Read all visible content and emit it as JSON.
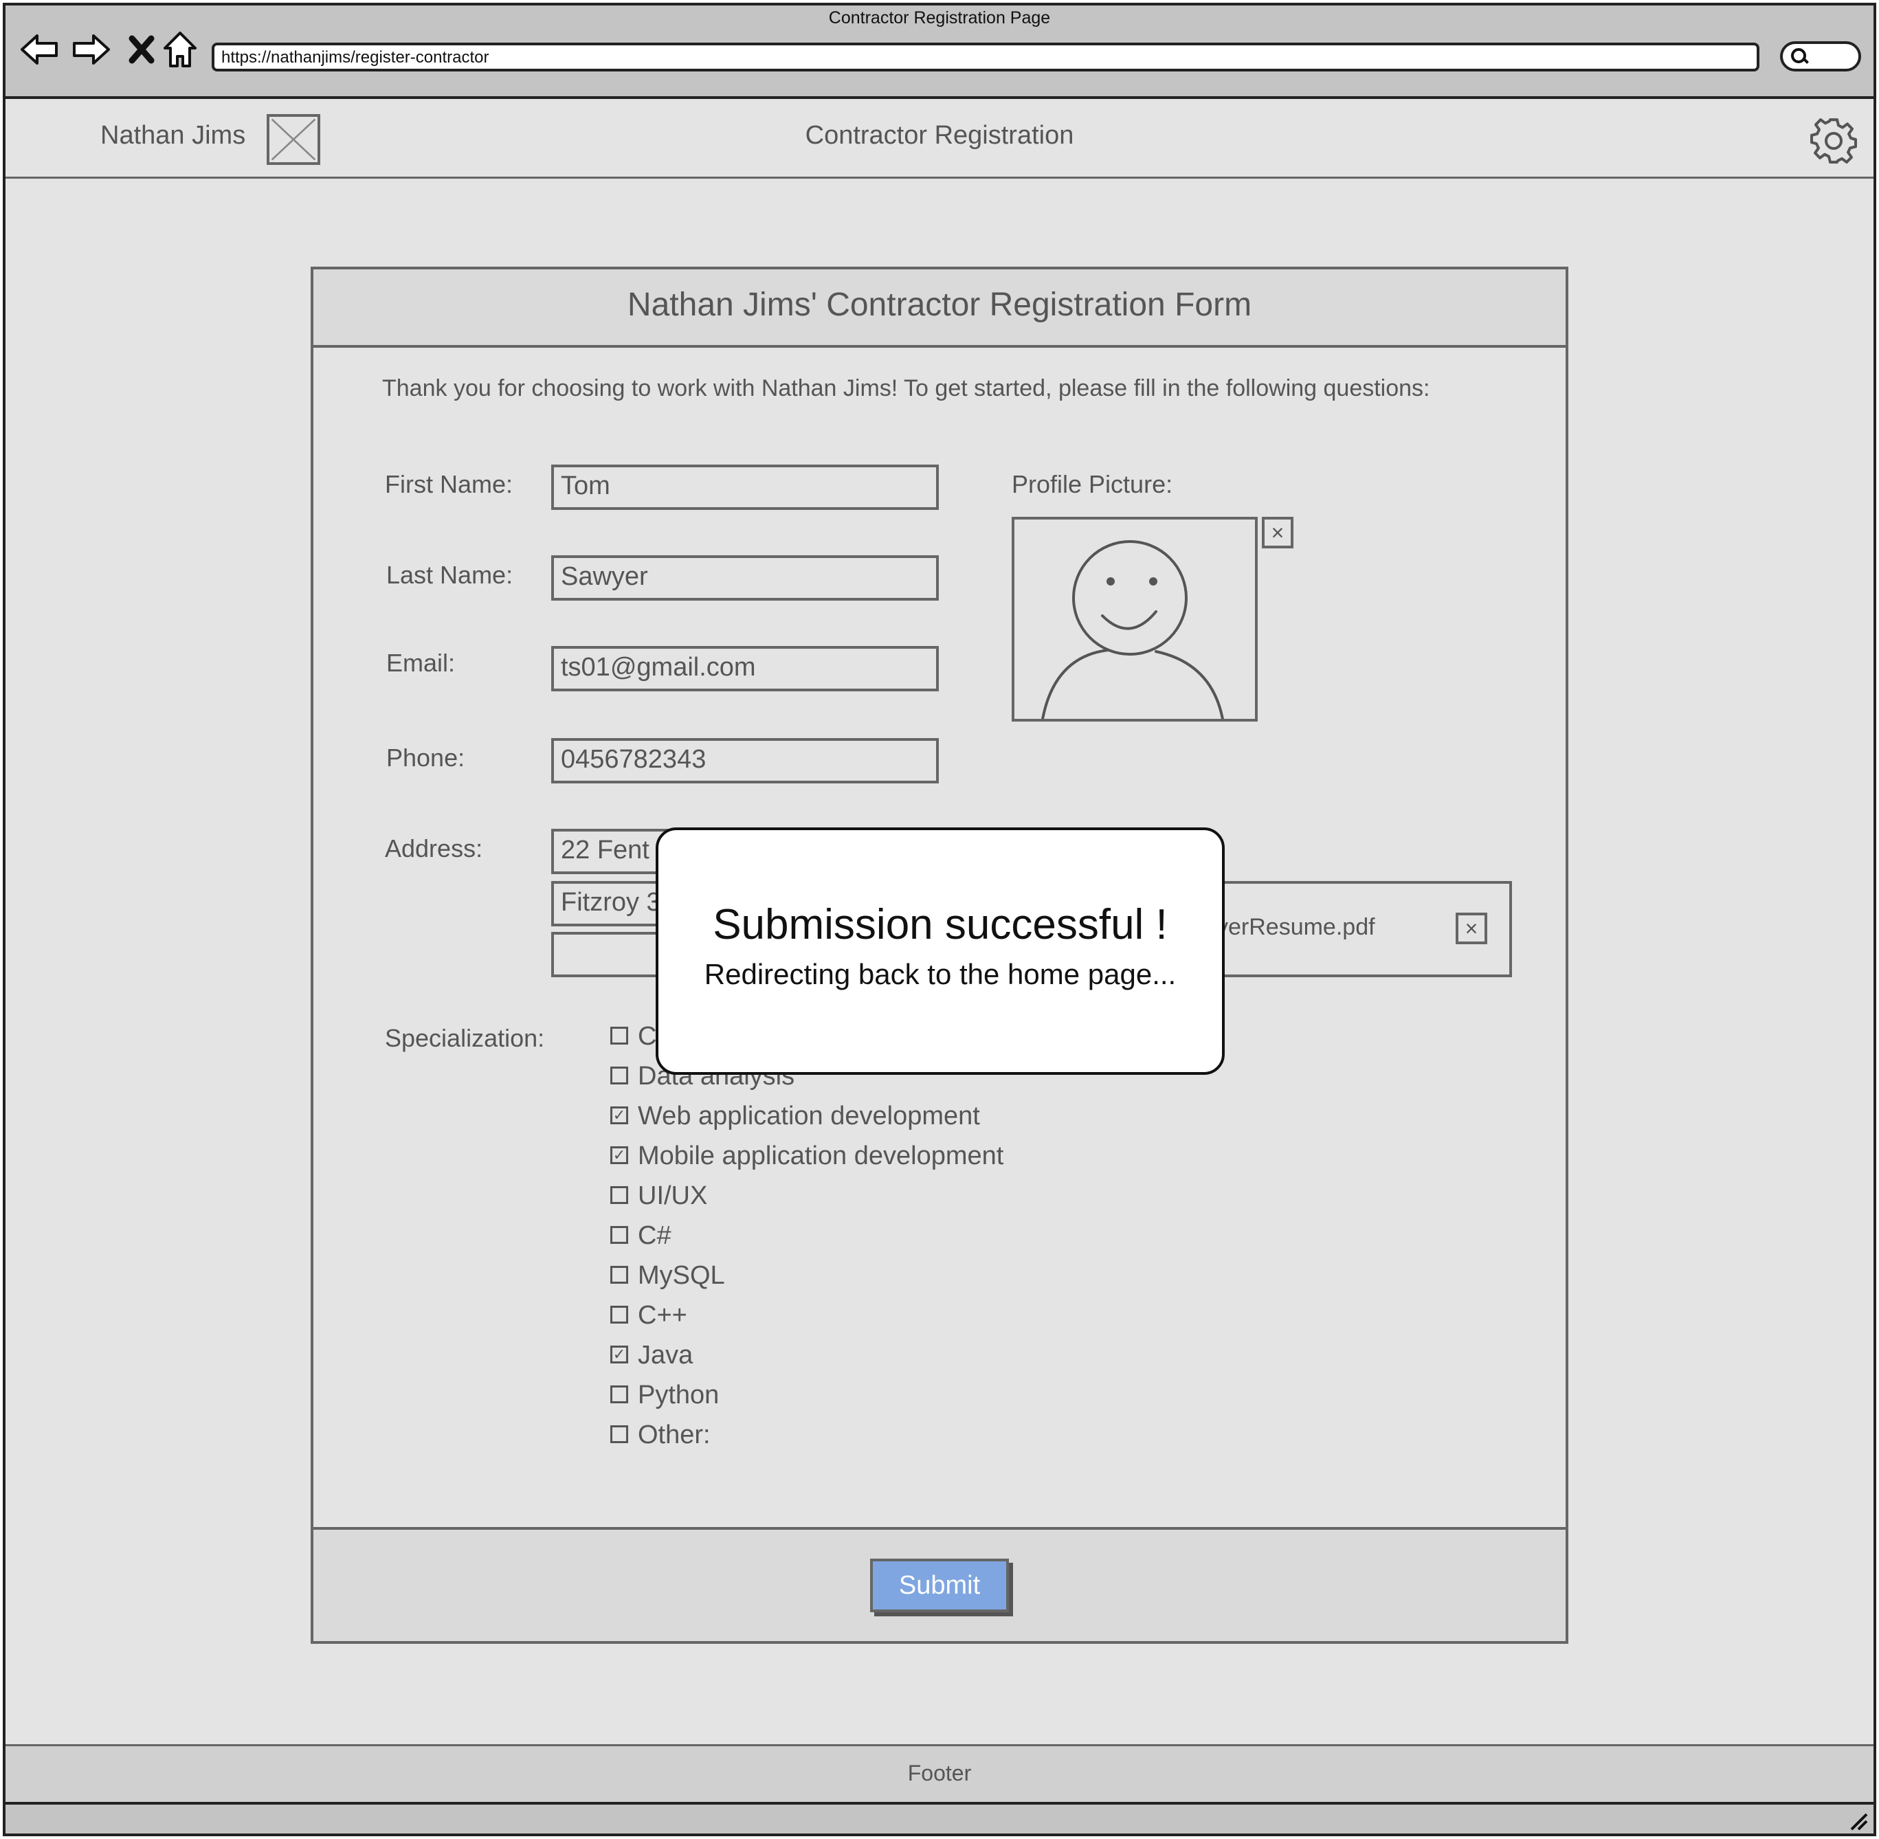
{
  "browser": {
    "window_title": "Contractor Registration Page",
    "url": "https://nathanjims/register-contractor",
    "nav_icons": [
      "back-arrow-icon",
      "forward-arrow-icon",
      "close-icon",
      "home-icon"
    ],
    "search_icon": "magnifier-icon"
  },
  "header": {
    "brand_name": "Nathan Jims",
    "logo_icon": "image-placeholder-icon",
    "title": "Contractor Registration",
    "settings_icon": "gear-icon"
  },
  "form": {
    "title": "Nathan Jims' Contractor Registration Form",
    "intro": "Thank you for choosing to work with Nathan Jims! To get started, please fill in the following questions:",
    "first_name": {
      "label": "First Name:",
      "value": "Tom"
    },
    "last_name": {
      "label": "Last Name:",
      "value": "Sawyer"
    },
    "email": {
      "label": "Email:",
      "value": "ts01@gmail.com"
    },
    "phone": {
      "label": "Phone:",
      "value": "0456782343"
    },
    "address": {
      "label": "Address:",
      "line1": "22 Fent",
      "line2": "Fitzroy 3",
      "line3": ""
    },
    "profile_picture": {
      "label": "Profile Picture:",
      "remove_label": "×"
    },
    "resume": {
      "label_fragment": ":",
      "file_name_fragment": "yerResume.pdf",
      "remove_label": "×"
    },
    "specialization": {
      "label": "Specialization:",
      "options": [
        {
          "label": "C",
          "checked": false
        },
        {
          "label": "Data analysis",
          "checked": false
        },
        {
          "label": "Web application development",
          "checked": true
        },
        {
          "label": "Mobile application development",
          "checked": true
        },
        {
          "label": "UI/UX",
          "checked": false
        },
        {
          "label": "C#",
          "checked": false
        },
        {
          "label": "MySQL",
          "checked": false
        },
        {
          "label": "C++",
          "checked": false
        },
        {
          "label": "Java",
          "checked": true
        },
        {
          "label": "Python",
          "checked": false
        },
        {
          "label": "Other:",
          "checked": false
        }
      ]
    },
    "submit_label": "Submit"
  },
  "modal": {
    "title": "Submission successful !",
    "subtitle": "Redirecting back to the home page..."
  },
  "footer": {
    "text": "Footer"
  },
  "colors": {
    "submit_button": "#7fa6e0",
    "frame": "#222222",
    "wireframe_gray": "#666666"
  }
}
